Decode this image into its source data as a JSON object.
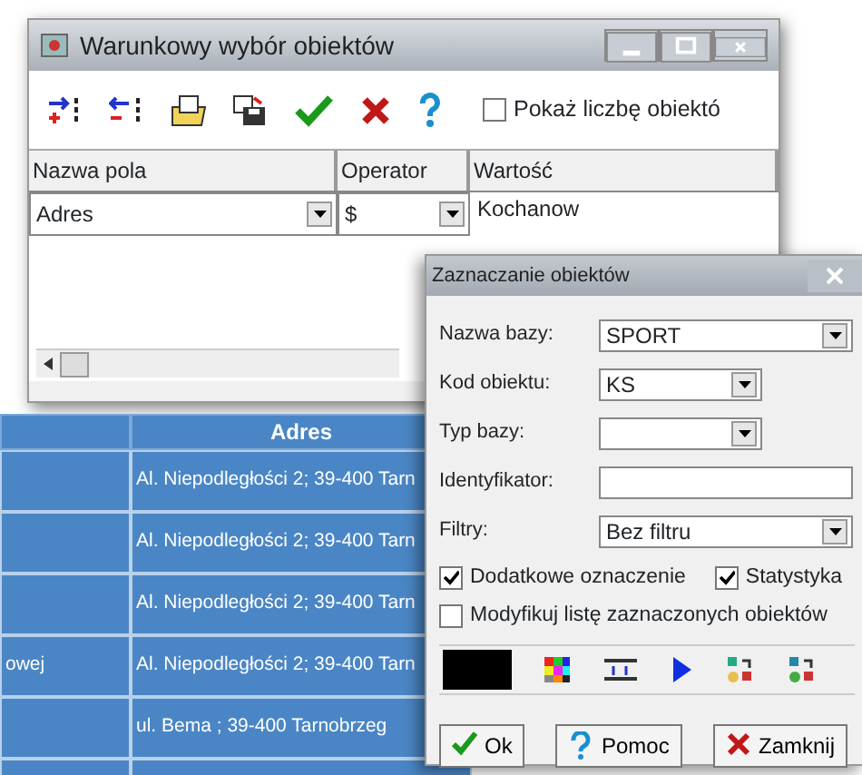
{
  "main_window": {
    "title": "Warunkowy wybór obiektów",
    "show_count": {
      "label": "Pokaż liczbę obiektó",
      "checked": false
    },
    "grid": {
      "columns": [
        "Nazwa pola",
        "Operator",
        "Wartość"
      ],
      "rows": [
        {
          "field": "Adres",
          "operator": "$",
          "value": "Kochanow"
        }
      ]
    }
  },
  "results_table": {
    "header": "Adres",
    "rows": [
      {
        "address": "Al. Niepodległości 2; 39-400 Tarn"
      },
      {
        "address": "Al. Niepodległości 2; 39-400 Tarn"
      },
      {
        "address": "Al. Niepodległości 2; 39-400 Tarn"
      },
      {
        "column_1": "owej",
        "address": "Al. Niepodległości 2; 39-400 Tarn"
      },
      {
        "address": "ul. Bema ; 39-400 Tarnobrzeg"
      }
    ]
  },
  "dialog": {
    "title": "Zaznaczanie obiektów",
    "fields": [
      {
        "label": "Nazwa bazy:",
        "kind": "combo_wide",
        "value": "SPORT"
      },
      {
        "label": "Kod obiektu:",
        "kind": "combo_short",
        "value": "KS"
      },
      {
        "label": "Typ bazy:",
        "kind": "combo_short"
      },
      {
        "label": "Identyfikator:",
        "kind": "text"
      },
      {
        "label": "Filtry:",
        "kind": "combo_wide",
        "value": "Bez filtru"
      }
    ],
    "checkboxes": [
      {
        "label": "Dodatkowe oznaczenie",
        "checked": true
      },
      {
        "label": "Statystyka",
        "checked": true
      },
      {
        "label": "Modyfikuj listę zaznaczonych obiektów",
        "checked": false
      }
    ],
    "buttons": [
      {
        "label": "Ok",
        "kind": "ok"
      },
      {
        "label": "Pomoc",
        "kind": "help"
      },
      {
        "label": "Zamknij",
        "kind": "close"
      }
    ]
  }
}
